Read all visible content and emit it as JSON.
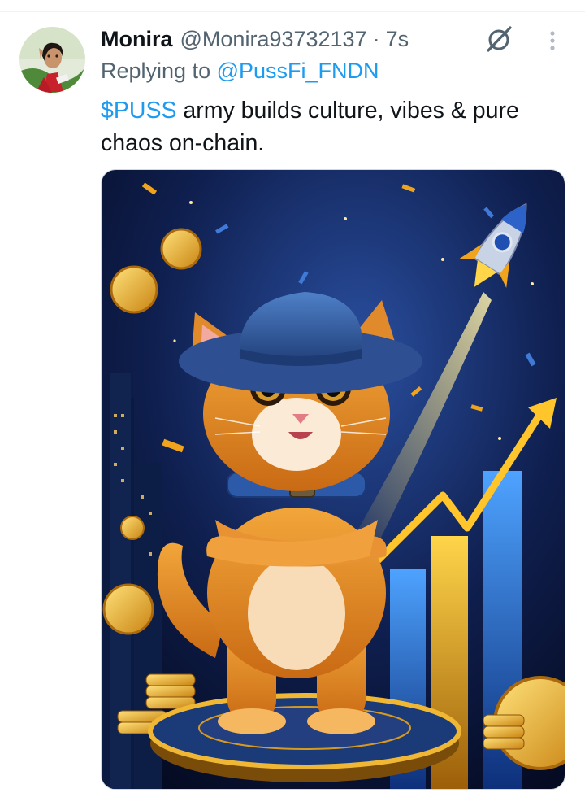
{
  "tweet": {
    "display_name": "Monira",
    "handle": "@Monira93732137",
    "separator": "·",
    "time": "7s",
    "replying_prefix": "Replying to",
    "replying_to": "@PussFi_FNDN",
    "cashtag": "$PUSS",
    "text_rest": " army builds culture, vibes & pure chaos on-chain.",
    "icons": [
      "avatar-photo",
      "grok-icon",
      "more-icon"
    ]
  },
  "colors": {
    "link": "#1d9bf0",
    "text": "#0f1419",
    "secondary": "#536471"
  }
}
